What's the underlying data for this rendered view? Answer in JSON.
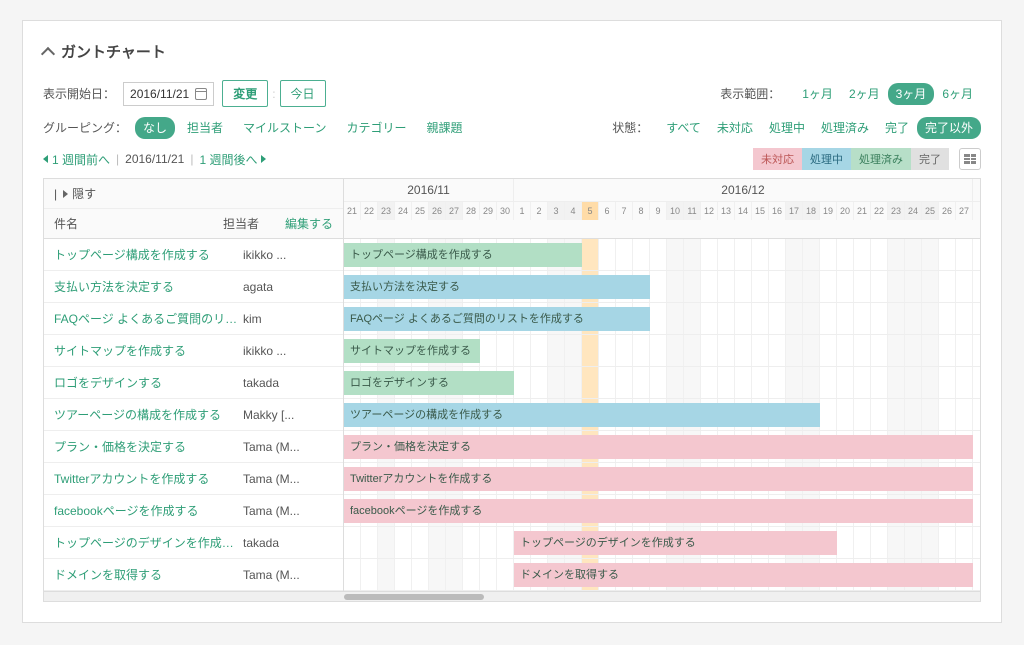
{
  "title": "ガントチャート",
  "controls": {
    "start_date_label": "表示開始日：",
    "start_date_value": "2016/11/21",
    "change_btn": "変更",
    "today_btn": "今日",
    "range_label": "表示範囲：",
    "range_options": [
      "1ヶ月",
      "2ヶ月",
      "3ヶ月",
      "6ヶ月"
    ],
    "range_active": "3ヶ月",
    "grouping_label": "グルーピング：",
    "grouping_options": [
      "なし",
      "担当者",
      "マイルストーン",
      "カテゴリー",
      "親課題"
    ],
    "grouping_active": "なし",
    "status_label": "状態：",
    "status_options": [
      "すべて",
      "未対応",
      "処理中",
      "処理済み",
      "完了",
      "完了以外"
    ],
    "status_active": "完了以外"
  },
  "nav": {
    "prev": "1 週間前へ",
    "date": "2016/11/21",
    "next": "1 週間後へ"
  },
  "legend": [
    "未対応",
    "処理中",
    "処理済み",
    "完了"
  ],
  "table": {
    "hide": "隠す",
    "col_subject": "件名",
    "col_assignee": "担当者",
    "col_edit": "編集する"
  },
  "timeline": {
    "day_width": 17,
    "months": [
      {
        "label": "2016/11",
        "days": 10
      },
      {
        "label": "2016/12",
        "days": 27
      }
    ],
    "days": [
      {
        "n": "21",
        "wkend": false
      },
      {
        "n": "22",
        "wkend": false
      },
      {
        "n": "23",
        "wkend": true
      },
      {
        "n": "24",
        "wkend": false
      },
      {
        "n": "25",
        "wkend": false
      },
      {
        "n": "26",
        "wkend": true
      },
      {
        "n": "27",
        "wkend": true
      },
      {
        "n": "28",
        "wkend": false
      },
      {
        "n": "29",
        "wkend": false
      },
      {
        "n": "30",
        "wkend": false
      },
      {
        "n": "1",
        "wkend": false
      },
      {
        "n": "2",
        "wkend": false
      },
      {
        "n": "3",
        "wkend": true
      },
      {
        "n": "4",
        "wkend": true
      },
      {
        "n": "5",
        "wkend": false,
        "marker": true
      },
      {
        "n": "6",
        "wkend": false
      },
      {
        "n": "7",
        "wkend": false
      },
      {
        "n": "8",
        "wkend": false
      },
      {
        "n": "9",
        "wkend": false
      },
      {
        "n": "10",
        "wkend": true
      },
      {
        "n": "11",
        "wkend": true
      },
      {
        "n": "12",
        "wkend": false
      },
      {
        "n": "13",
        "wkend": false
      },
      {
        "n": "14",
        "wkend": false
      },
      {
        "n": "15",
        "wkend": false
      },
      {
        "n": "16",
        "wkend": false
      },
      {
        "n": "17",
        "wkend": true
      },
      {
        "n": "18",
        "wkend": true
      },
      {
        "n": "19",
        "wkend": false
      },
      {
        "n": "20",
        "wkend": false
      },
      {
        "n": "21",
        "wkend": false
      },
      {
        "n": "22",
        "wkend": false
      },
      {
        "n": "23",
        "wkend": true
      },
      {
        "n": "24",
        "wkend": true
      },
      {
        "n": "25",
        "wkend": true
      },
      {
        "n": "26",
        "wkend": false
      },
      {
        "n": "27",
        "wkend": false
      }
    ]
  },
  "tasks": [
    {
      "name": "トップページ構成を作成する",
      "assignee": "ikikko ...",
      "bar_label": "トップページ構成を作成する",
      "start": 0,
      "span": 14,
      "color": "green"
    },
    {
      "name": "支払い方法を決定する",
      "assignee": "agata",
      "bar_label": "支払い方法を決定する",
      "start": 0,
      "span": 18,
      "color": "blue"
    },
    {
      "name": "FAQページ よくあるご質問のリスト...",
      "assignee": "kim",
      "bar_label": "FAQページ よくあるご質問のリストを作成する",
      "start": 0,
      "span": 18,
      "color": "blue"
    },
    {
      "name": "サイトマップを作成する",
      "assignee": "ikikko ...",
      "bar_label": "サイトマップを作成する",
      "start": 0,
      "span": 8,
      "color": "green"
    },
    {
      "name": "ロゴをデザインする",
      "assignee": "takada",
      "bar_label": "ロゴをデザインする",
      "start": 0,
      "span": 10,
      "color": "green"
    },
    {
      "name": "ツアーページの構成を作成する",
      "assignee": "Makky [...",
      "bar_label": "ツアーページの構成を作成する",
      "start": 0,
      "span": 28,
      "color": "blue"
    },
    {
      "name": "プラン・価格を決定する",
      "assignee": "Tama (M...",
      "bar_label": "プラン・価格を決定する",
      "start": 0,
      "span": 37,
      "color": "red"
    },
    {
      "name": "Twitterアカウントを作成する",
      "assignee": "Tama (M...",
      "bar_label": "Twitterアカウントを作成する",
      "start": 0,
      "span": 37,
      "color": "red"
    },
    {
      "name": "facebookページを作成する",
      "assignee": "Tama (M...",
      "bar_label": "facebookページを作成する",
      "start": 0,
      "span": 37,
      "color": "red"
    },
    {
      "name": "トップページのデザインを作成する",
      "assignee": "takada",
      "bar_label": "トップページのデザインを作成する",
      "start": 10,
      "span": 19,
      "color": "red"
    },
    {
      "name": "ドメインを取得する",
      "assignee": "Tama (M...",
      "bar_label": "ドメインを取得する",
      "start": 10,
      "span": 27,
      "color": "red"
    }
  ]
}
